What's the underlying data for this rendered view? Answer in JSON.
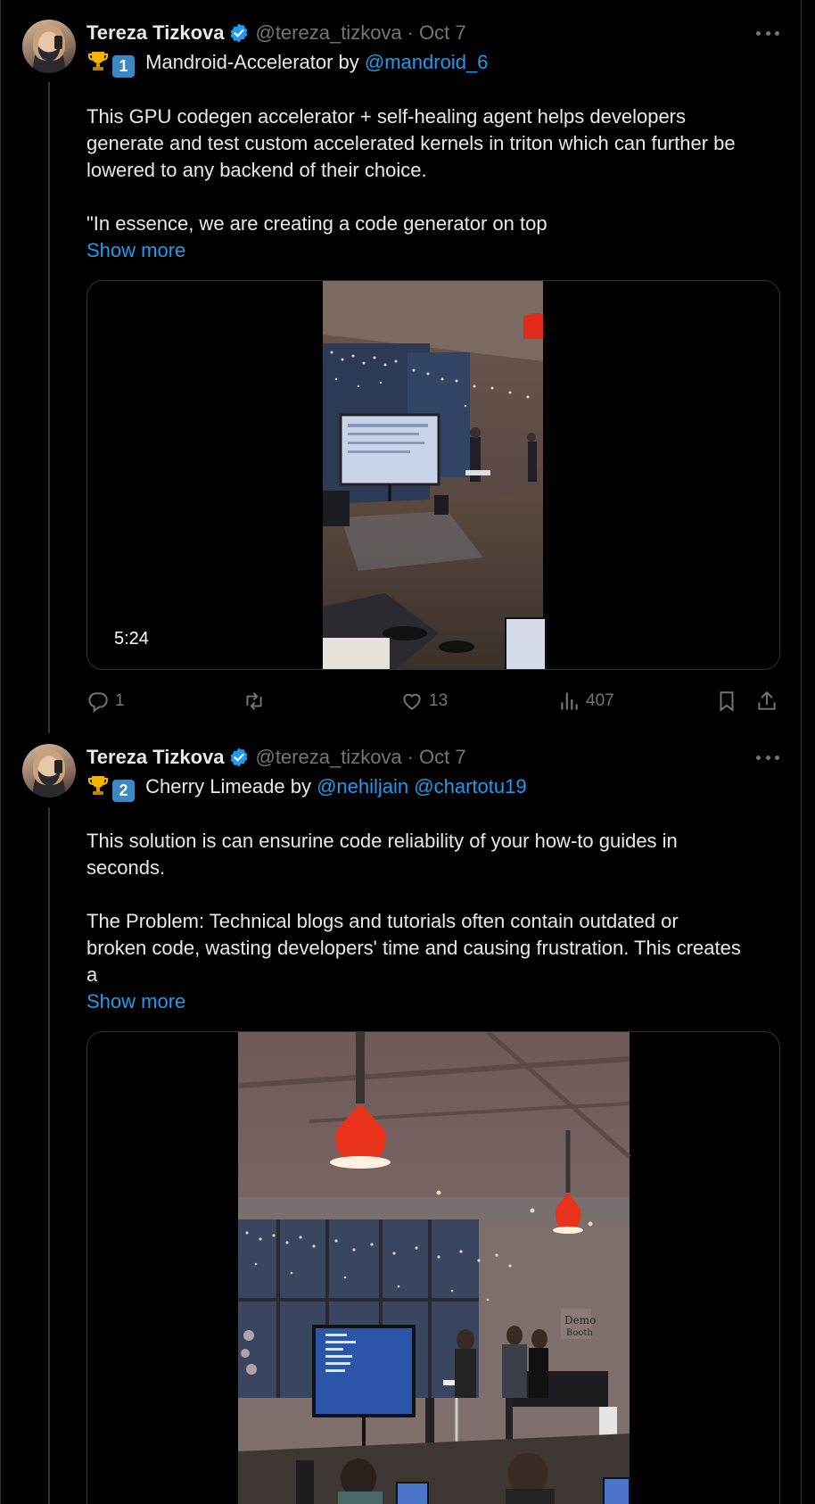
{
  "tweets": [
    {
      "author_name": "Tereza Tizkova",
      "handle": "@tereza_tizkova",
      "separator": "·",
      "date": "Oct 7",
      "rank": "1",
      "project_title": " Mandroid-Accelerator by ",
      "mention_1": "@mandroid_6",
      "body_lines": [
        "This GPU codegen accelerator + self-healing agent helps developers",
        "generate and test custom accelerated kernels in triton which can further be",
        "lowered to any backend of their choice."
      ],
      "quote_line": "\"In essence, we are creating a code generator on top",
      "show_more": "Show more",
      "video_duration": "5:24",
      "replies": "1",
      "retweets": "",
      "likes": "13",
      "views": "407"
    },
    {
      "author_name": "Tereza Tizkova",
      "handle": "@tereza_tizkova",
      "separator": "·",
      "date": "Oct 7",
      "rank": "2",
      "project_title": " Cherry Limeade by ",
      "mention_1": "@nehiljain",
      "mention_2": "@chartotu19",
      "body_lines": [
        "This solution is can ensurine code reliability of your how-to guides in",
        "seconds."
      ],
      "problem_lines": [
        "The Problem: Technical blogs and tutorials often contain outdated or",
        "broken code, wasting developers' time and causing frustration. This creates",
        "a"
      ],
      "show_more": "Show more"
    }
  ],
  "colors": {
    "background": "#000000",
    "text": "#e7e9ea",
    "muted": "#71767b",
    "link": "#1d9bf0",
    "verified": "#1d9bf0",
    "border": "#2f3336"
  },
  "icons": [
    "verified-badge-icon",
    "trophy-icon",
    "more-icon",
    "reply-icon",
    "retweet-icon",
    "like-icon",
    "views-icon",
    "bookmark-icon",
    "share-icon"
  ]
}
